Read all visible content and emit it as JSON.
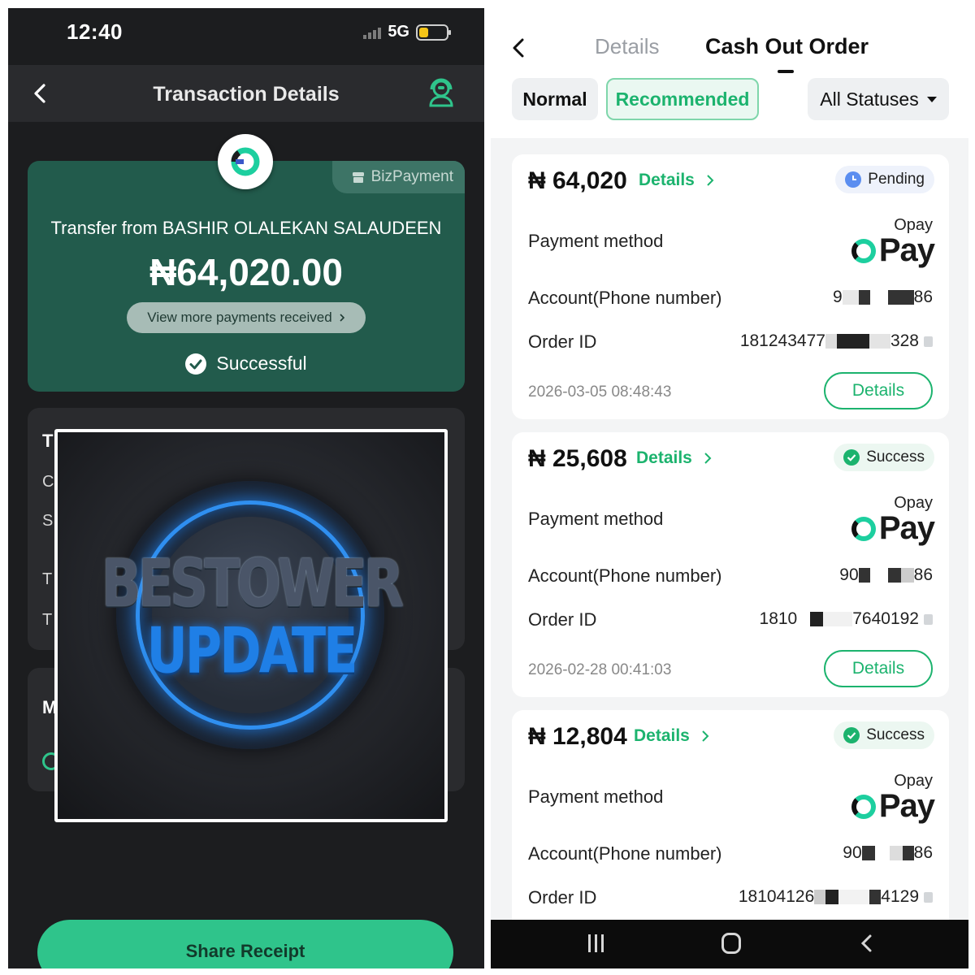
{
  "left_phone": {
    "status_bar": {
      "time": "12:40",
      "network": "5G"
    },
    "header": {
      "title": "Transaction Details"
    },
    "receipt": {
      "tag": "BizPayment",
      "transfer_from": "Transfer from BASHIR OLALEKAN SALAUDEEN",
      "amount": "₦64,020.00",
      "view_more": "View more payments received",
      "status": "Successful"
    },
    "hidden_rows": {
      "card1_heading": "T",
      "card1_row1": "C",
      "card1_row2": "S",
      "card1_row3": "T",
      "card1_row4": "T",
      "card2_heading": "M"
    },
    "overlay": {
      "line1": "BESTOWER",
      "line2": "UPDATE"
    },
    "share_button": "Share Receipt",
    "colors": {
      "card": "#225b4c",
      "accent": "#2fc48b"
    }
  },
  "right_phone": {
    "tabs": {
      "inactive": "Details",
      "active": "Cash Out Order"
    },
    "filters": {
      "normal": "Normal",
      "recommended": "Recommended",
      "status": "All Statuses"
    },
    "labels": {
      "payment_method": "Payment method",
      "account": "Account(Phone number)",
      "order_id": "Order ID",
      "details_link": "Details",
      "details_button": "Details",
      "opay_name": "Opay",
      "opay_logo": "Pay"
    },
    "orders": [
      {
        "amount": "₦ 64,020",
        "status": "Pending",
        "account_start": "9",
        "account_end": "86",
        "order_start": "181243477",
        "order_end": "328",
        "date": "2026-03-05 08:48:43"
      },
      {
        "amount": "₦ 25,608",
        "status": "Success",
        "account_start": "90",
        "account_end": "86",
        "order_start": "1810",
        "order_end": "7640192",
        "date": "2026-02-28 00:41:03"
      },
      {
        "amount": "₦ 12,804",
        "status": "Success",
        "account_start": "90",
        "account_end": "86",
        "order_start": "18104126",
        "order_end": "4129",
        "date": ""
      }
    ],
    "colors": {
      "green": "#1cb36e",
      "pending": "#5b8ef0"
    }
  }
}
